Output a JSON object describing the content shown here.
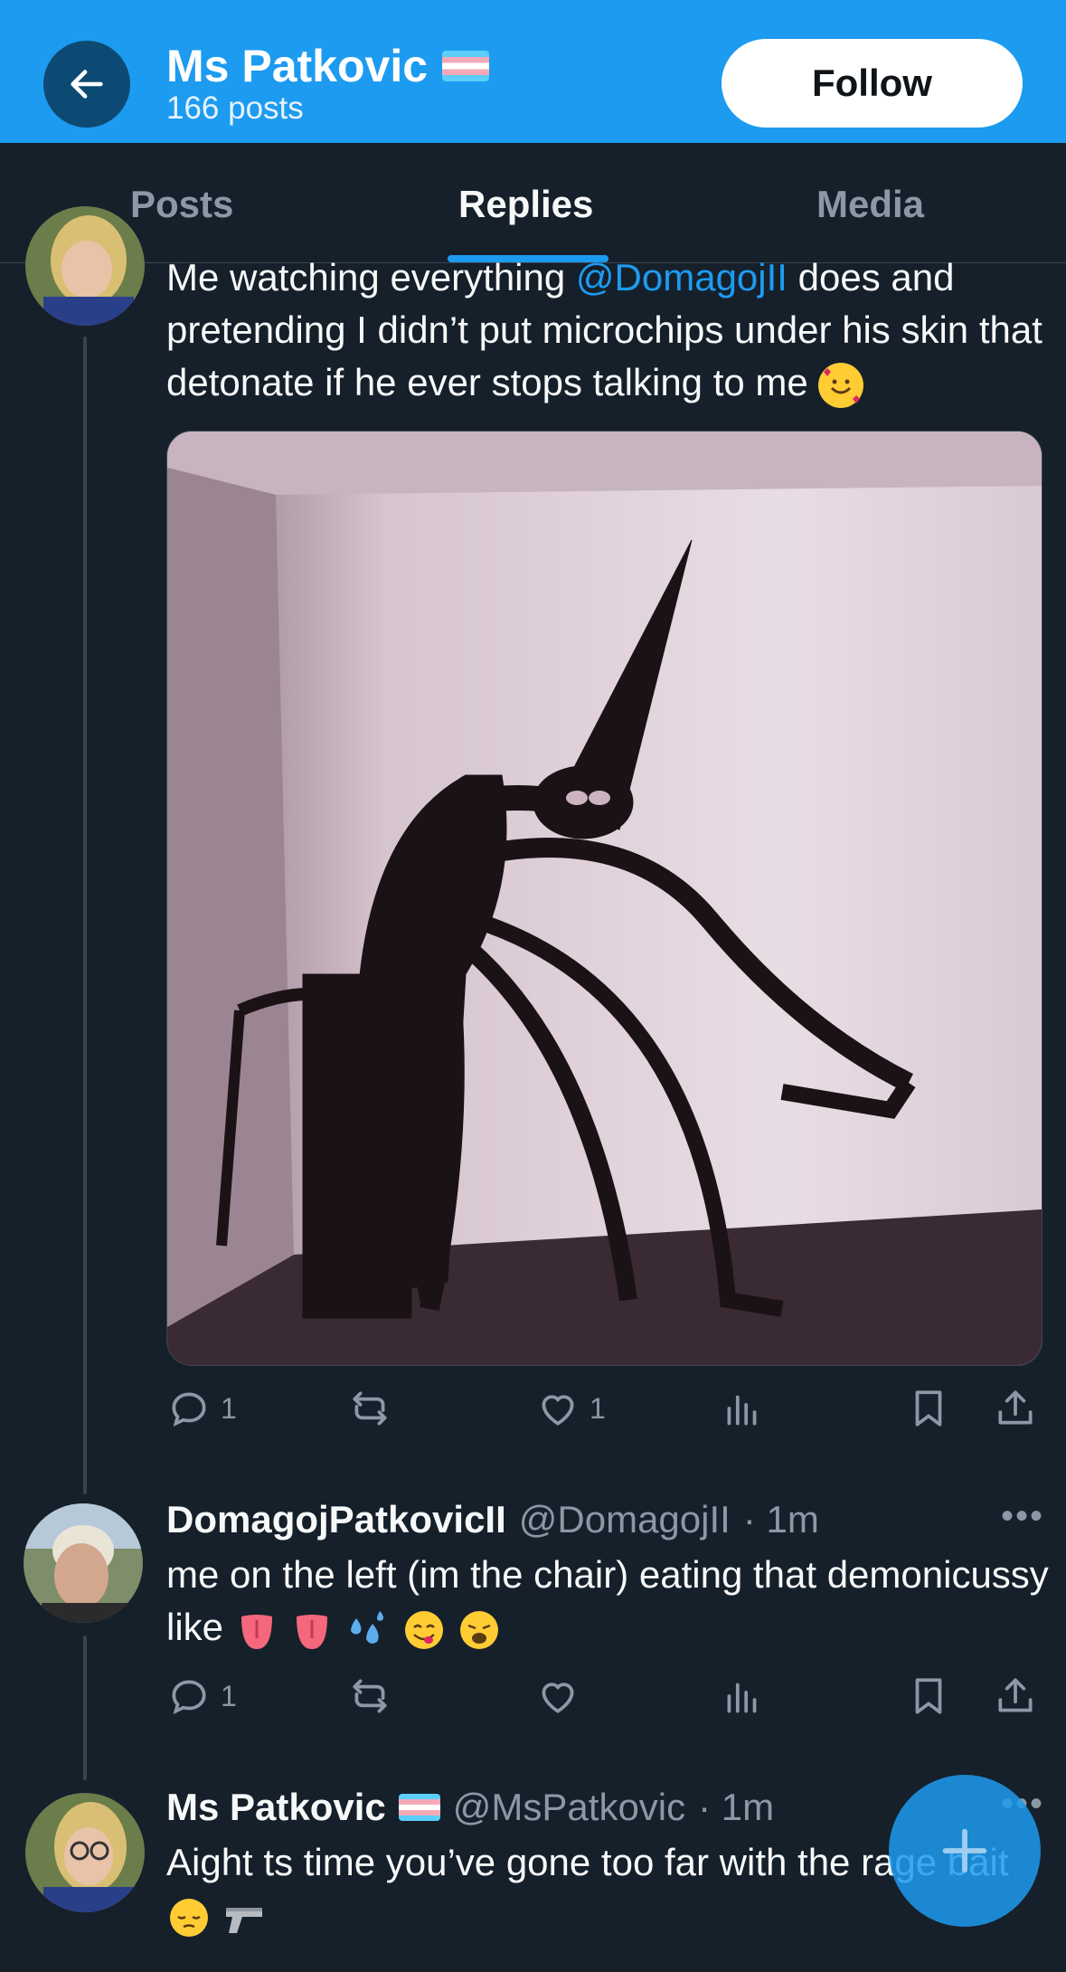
{
  "header": {
    "name": "Ms Patkovic",
    "posts_count": "166 posts",
    "follow_label": "Follow"
  },
  "tabs": [
    {
      "label": "Posts",
      "active": false
    },
    {
      "label": "Replies",
      "active": true
    },
    {
      "label": "Media",
      "active": false
    }
  ],
  "post1": {
    "text_before": "Me watching everything ",
    "mention": "@DomagojII",
    "text_after": " does and pretending I didn’t put microchips under his skin that detonate if he ever stops talking to me",
    "emoji": "smiling-face-with-hearts",
    "replies": "1",
    "likes": "1"
  },
  "post2": {
    "name": "DomagojPatkovicII",
    "handle": "@DomagojII",
    "time": "· 1m",
    "text": "me on the left (im the chair) eating that demonicussy like",
    "emojis": [
      "tongue",
      "tongue",
      "sweat-droplets",
      "face-savoring-food",
      "weary-face"
    ],
    "replies": "1"
  },
  "post3": {
    "name": "Ms Patkovic",
    "handle": "@MsPatkovic",
    "time": "· 1m",
    "text": "Aight ts time you’ve gone too far with the rage bait",
    "emojis": [
      "pensive-face",
      "pistol"
    ]
  },
  "colors": {
    "background": "#15202b",
    "accent": "#1d9bf0",
    "muted": "#8b98a5",
    "divider": "#38444d"
  }
}
